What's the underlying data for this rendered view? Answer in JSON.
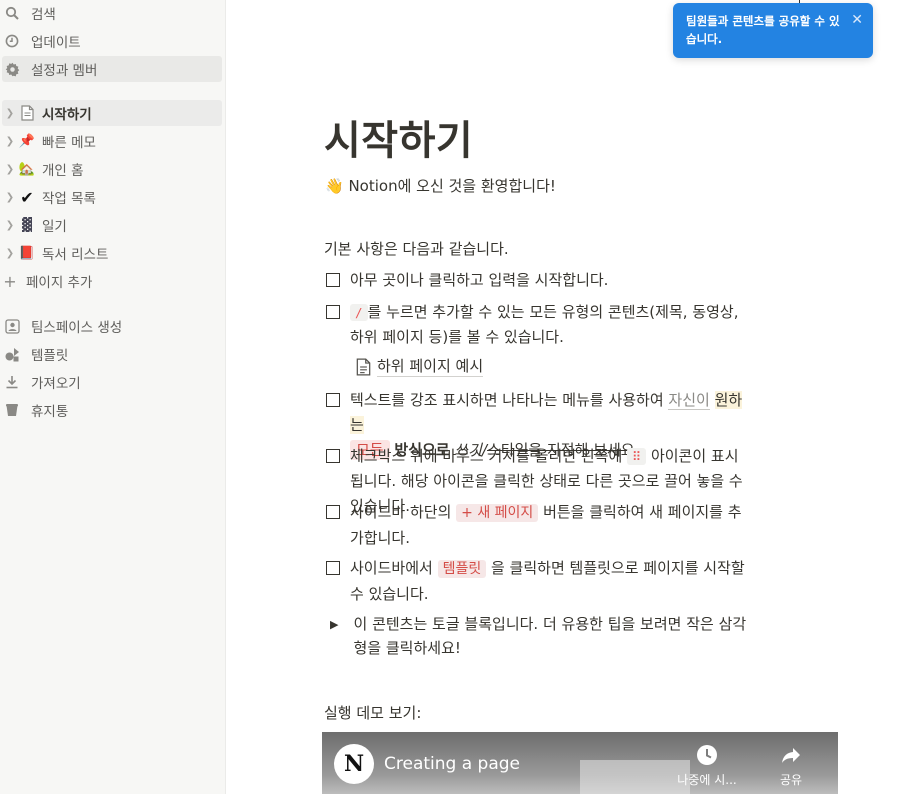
{
  "sidebar": {
    "top_items": [
      {
        "icon": "search-icon",
        "label": "검색"
      },
      {
        "icon": "clock-icon",
        "label": "업데이트"
      },
      {
        "icon": "gear-icon",
        "label": "설정과 멤버"
      }
    ],
    "pages": [
      {
        "icon": "document-icon",
        "glyph": "📄",
        "label": "시작하기"
      },
      {
        "icon": "pushpin-icon",
        "glyph": "📌",
        "label": "빠른 메모"
      },
      {
        "icon": "house-icon",
        "glyph": "🏡",
        "label": "개인 홈"
      },
      {
        "icon": "checkmark-icon",
        "glyph": "✔",
        "label": "작업 목록"
      },
      {
        "icon": "notebook-icon",
        "glyph": "▓",
        "label": "일기"
      },
      {
        "icon": "book-icon",
        "glyph": "📕",
        "label": "독서 리스트"
      }
    ],
    "add_page": "페이지 추가",
    "bottom_items": [
      {
        "icon": "teamspace-icon",
        "label": "팀스페이스 생성"
      },
      {
        "icon": "template-icon",
        "label": "템플릿"
      },
      {
        "icon": "import-icon",
        "label": "가져오기"
      },
      {
        "icon": "trash-icon",
        "label": "휴지통"
      }
    ]
  },
  "toast": {
    "message": "팀원들과 콘텐츠를 공유할 수 있습니다.",
    "close": "✕"
  },
  "page": {
    "title": "시작하기",
    "welcome": "👋 Notion에 오신 것을 환영합니다!",
    "basics": "기본 사항은 다음과 같습니다.",
    "todo1": "아무 곳이나 클릭하고 입력을 시작합니다.",
    "todo2_code": "/",
    "todo2_text": "를 누르면 추가할 수 있는 모든 유형의 콘텐츠(제목, 동영상, 하위 페이지 등)를 볼 수 있습니다.",
    "subpage_label": "하위 페이지 예시",
    "todo3_a": "텍스트를 강조 표시하면 나타나는 메뉴를 사용하여 ",
    "todo3_link": "자신이",
    "todo3_space": " ",
    "todo3_yellow": "원하는",
    "todo3_red": "모든",
    "todo3_bold": "방식으로",
    "todo3_italic": " 쓰기/",
    "todo3_strike": "스타일을 지정해 보세요.",
    "todo4_a": "체크박스 위에 마우스 커서를 올리면 왼쪽에 ",
    "todo4_code": "⠿",
    "todo4_b": " 아이콘이 표시됩니다. 해당 아이콘을 클릭한 상태로 다른 곳으로 끌어 놓을 수 있습니다.",
    "todo5_a": "사이드바 하단의 ",
    "todo5_code": "+ 새 페이지",
    "todo5_b": " 버튼을 클릭하여 새 페이지를 추가합니다.",
    "todo6_a": "사이드바에서 ",
    "todo6_code": "템플릿",
    "todo6_b": " 을 클릭하면 템플릿으로 페이지를 시작할 수 있습니다.",
    "toggle_text": "이 콘텐츠는 토글 블록입니다. 더 유용한 팁을 보려면 작은 삼각형을 클릭하세요!",
    "demo_label": "실행 데모 보기:"
  },
  "video": {
    "logo": "N",
    "title": "Creating a page",
    "watch_later": "나중에 시...",
    "share": "공유"
  }
}
